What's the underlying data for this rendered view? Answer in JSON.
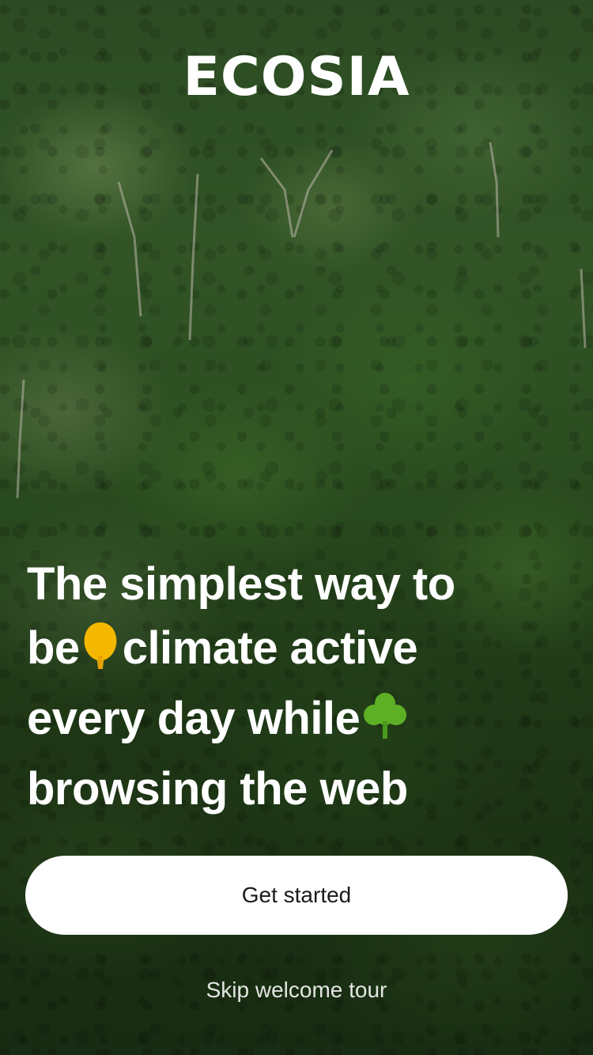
{
  "brand": {
    "logo_text": "ECOSIA"
  },
  "hero": {
    "line1": "The simplest way to",
    "line2_a": "be",
    "line2_b": "climate active",
    "line3": "every day while",
    "line4": "browsing the web",
    "emoji_1": "yellow-tree-icon",
    "emoji_2": "green-tree-icon"
  },
  "actions": {
    "primary_label": "Get started",
    "secondary_label": "Skip welcome tour"
  },
  "colors": {
    "yellow_tree": "#F5B800",
    "green_tree": "#5DB025",
    "button_bg": "#FFFFFF",
    "text": "#FFFFFF"
  }
}
